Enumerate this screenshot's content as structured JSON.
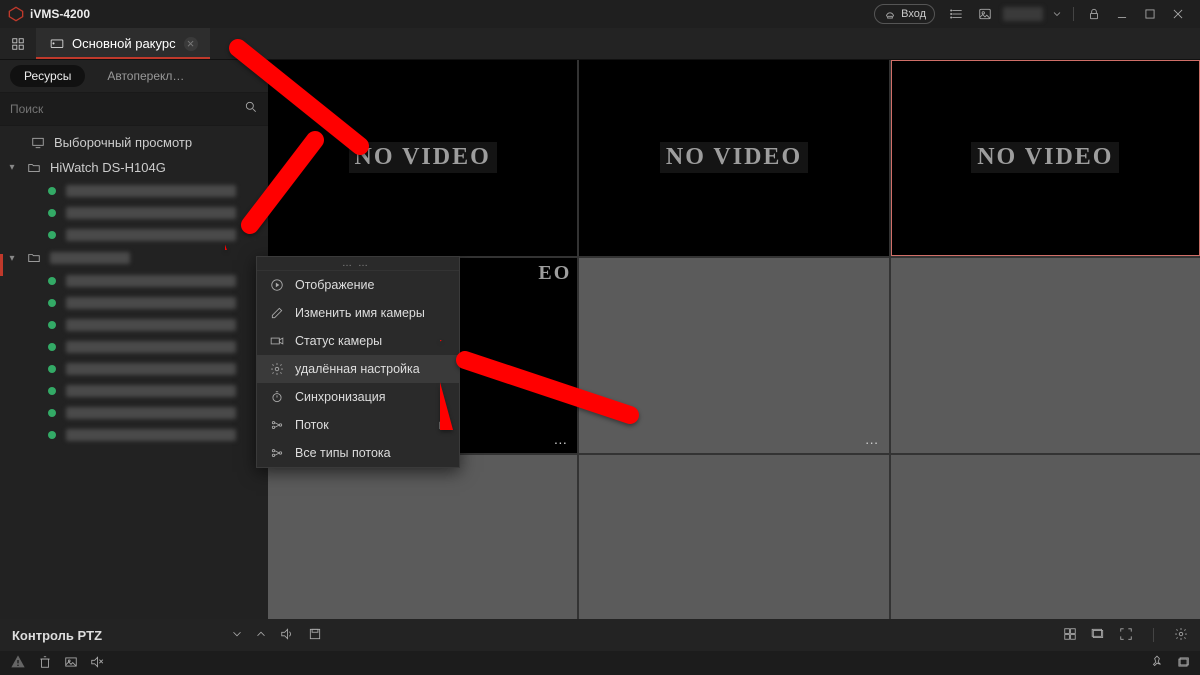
{
  "titlebar": {
    "app_name": "iVMS-4200",
    "login_label": "Вход"
  },
  "tabs": {
    "main_tab": "Основной ракурс"
  },
  "sidebar": {
    "tab_resources": "Ресурсы",
    "tab_autoswitch": "Автоперекл…",
    "search_placeholder": "Поиск",
    "item_selective_view": "Выборочный просмотр",
    "device_name": "HiWatch DS-H104G"
  },
  "context_menu": {
    "display": "Отображение",
    "rename": "Изменить имя камеры",
    "status": "Статус камеры",
    "remote_config": "удалённая настройка",
    "sync": "Синхронизация",
    "stream": "Поток",
    "all_stream_types": "Все типы потока"
  },
  "video": {
    "no_video": "NO VIDEO",
    "partial_fragment": "EO"
  },
  "ptzbar": {
    "label": "Контроль PTZ"
  },
  "colors": {
    "accent_red": "#c0392b"
  }
}
